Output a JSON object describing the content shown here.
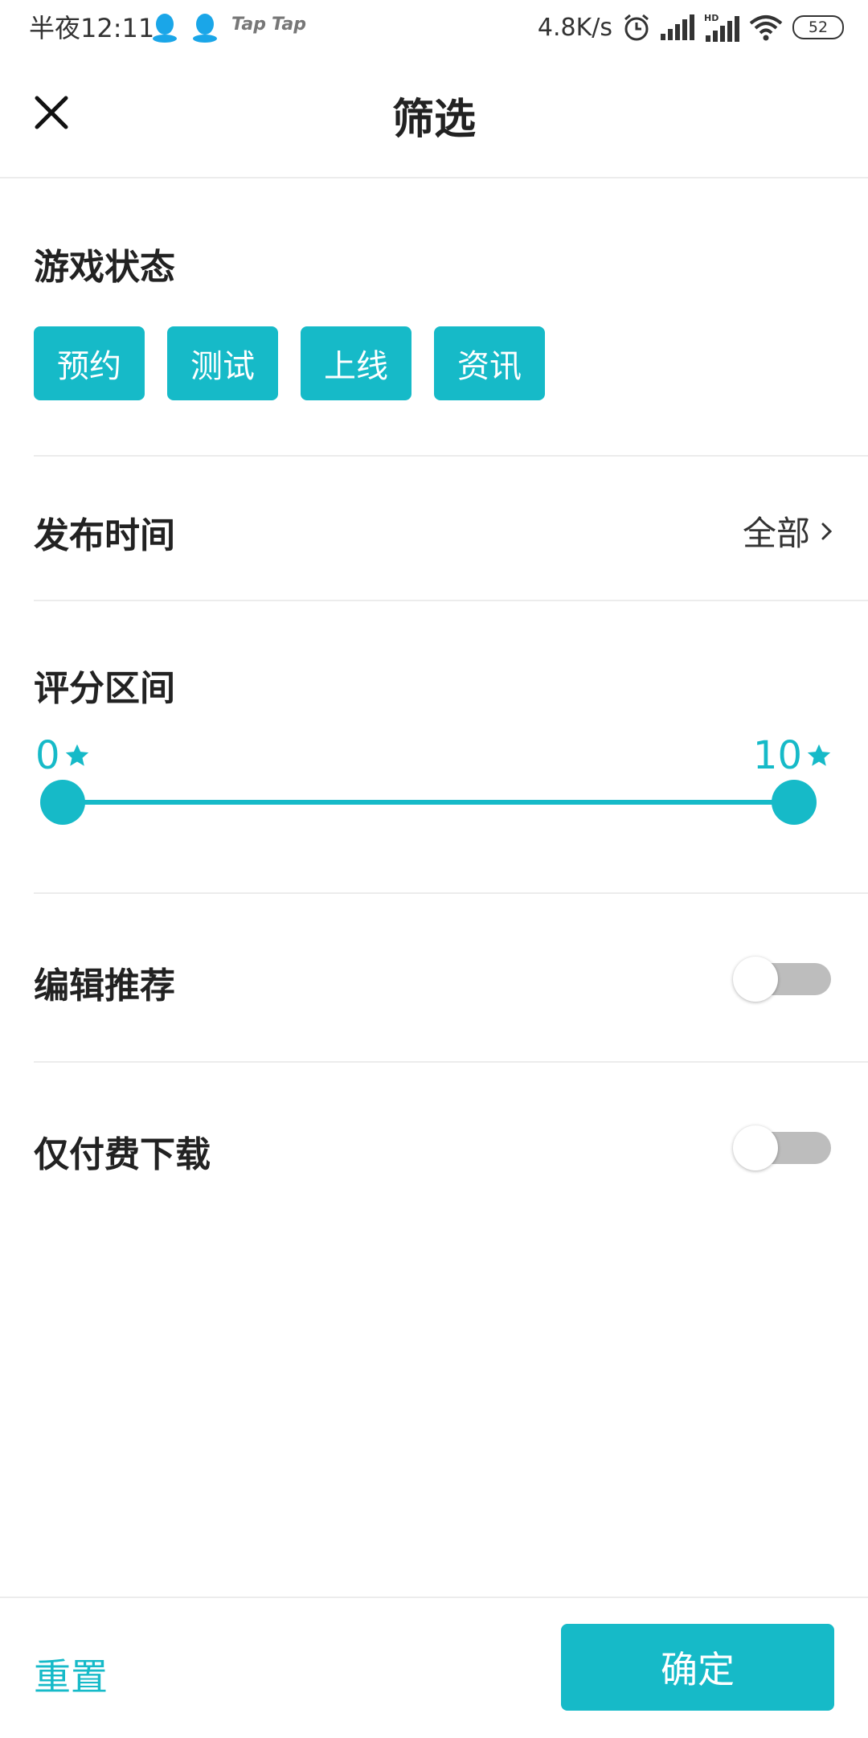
{
  "status_bar": {
    "time": "半夜12:11",
    "app_badges": [
      "Tap",
      "Tap"
    ],
    "network_speed": "4.8K/s",
    "battery": "52",
    "icons": [
      "qq-icon",
      "qq-icon",
      "alarm-icon",
      "signal-icon",
      "hd-signal-icon",
      "wifi-icon",
      "battery-icon"
    ]
  },
  "header": {
    "title": "筛选",
    "close_icon": "close-icon"
  },
  "game_status": {
    "title": "游戏状态",
    "tags": [
      "预约",
      "测试",
      "上线",
      "资讯"
    ]
  },
  "publish_time": {
    "title": "发布时间",
    "value": "全部",
    "icon": "chevron-right-icon"
  },
  "rating_range": {
    "title": "评分区间",
    "min": "0",
    "max": "10",
    "icon": "star-icon"
  },
  "editor_recommend": {
    "title": "编辑推荐",
    "enabled": false
  },
  "paid_only": {
    "title": "仅付费下载",
    "enabled": false
  },
  "footer": {
    "reset_label": "重置",
    "confirm_label": "确定"
  },
  "colors": {
    "accent": "#16bac8",
    "switch_off": "#bdbdbd"
  }
}
